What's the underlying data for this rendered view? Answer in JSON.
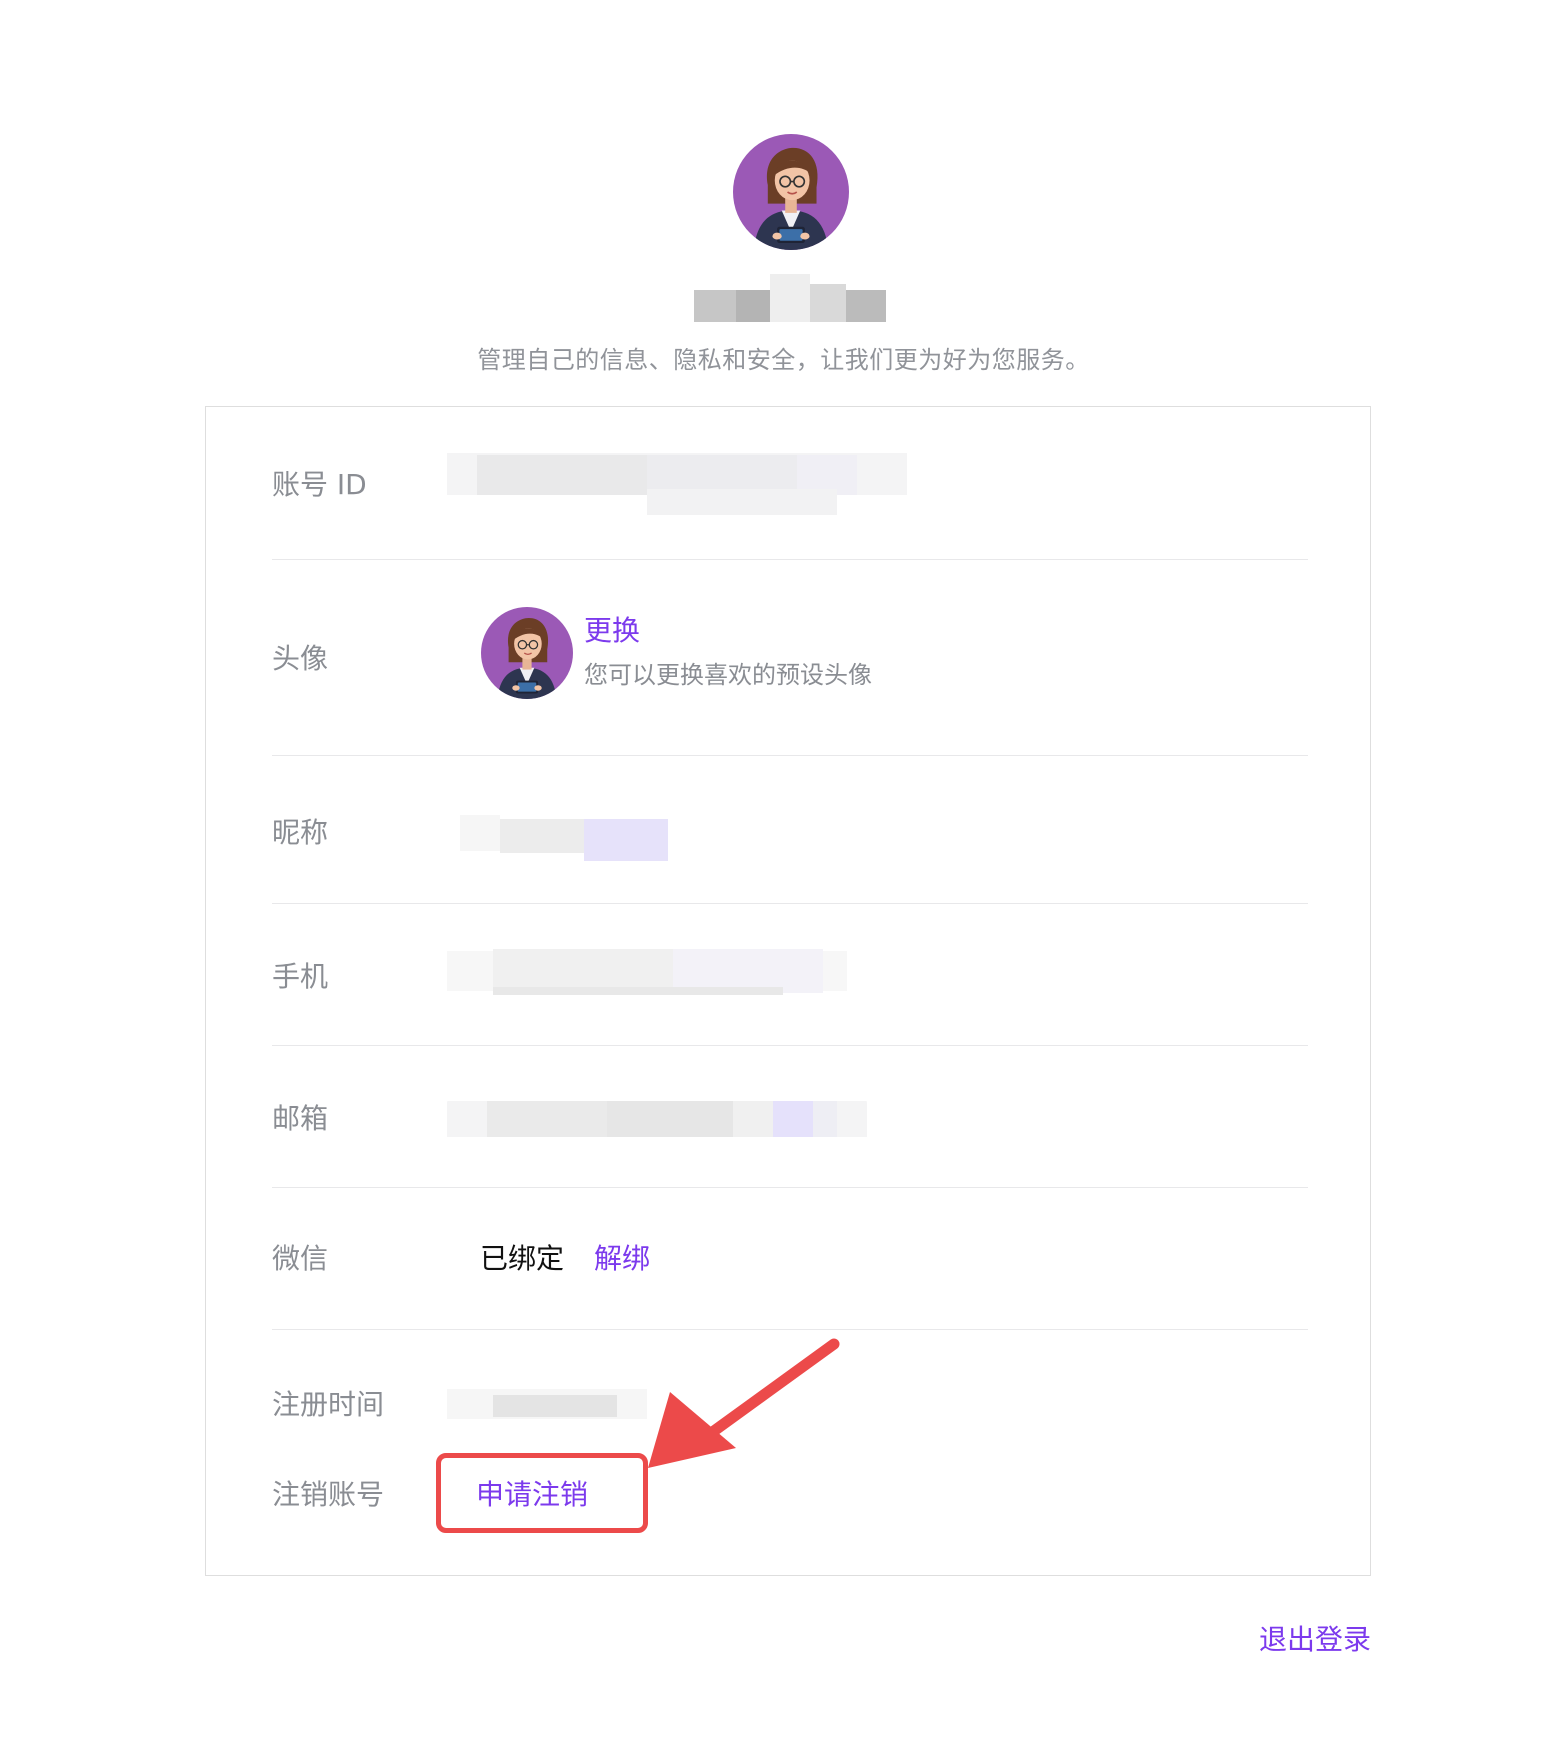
{
  "header": {
    "subtitle": "管理自己的信息、隐私和安全，让我们更为好为您服务。"
  },
  "rows": {
    "account_id": {
      "label": "账号 ID"
    },
    "avatar": {
      "label": "头像",
      "change_link": "更换",
      "hint": "您可以更换喜欢的预设头像"
    },
    "nickname": {
      "label": "昵称"
    },
    "phone": {
      "label": "手机"
    },
    "email": {
      "label": "邮箱"
    },
    "wechat": {
      "label": "微信",
      "status": "已绑定",
      "unbind_link": "解绑"
    },
    "register_time": {
      "label": "注册时间"
    },
    "cancel_account": {
      "label": "注销账号",
      "apply_link": "申请注销"
    }
  },
  "footer": {
    "logout_link": "退出登录"
  },
  "colors": {
    "accent": "#7c3aed",
    "highlight": "#ec4a4a",
    "label": "#8a8d93",
    "avatar_bg": "#9b59b6"
  }
}
